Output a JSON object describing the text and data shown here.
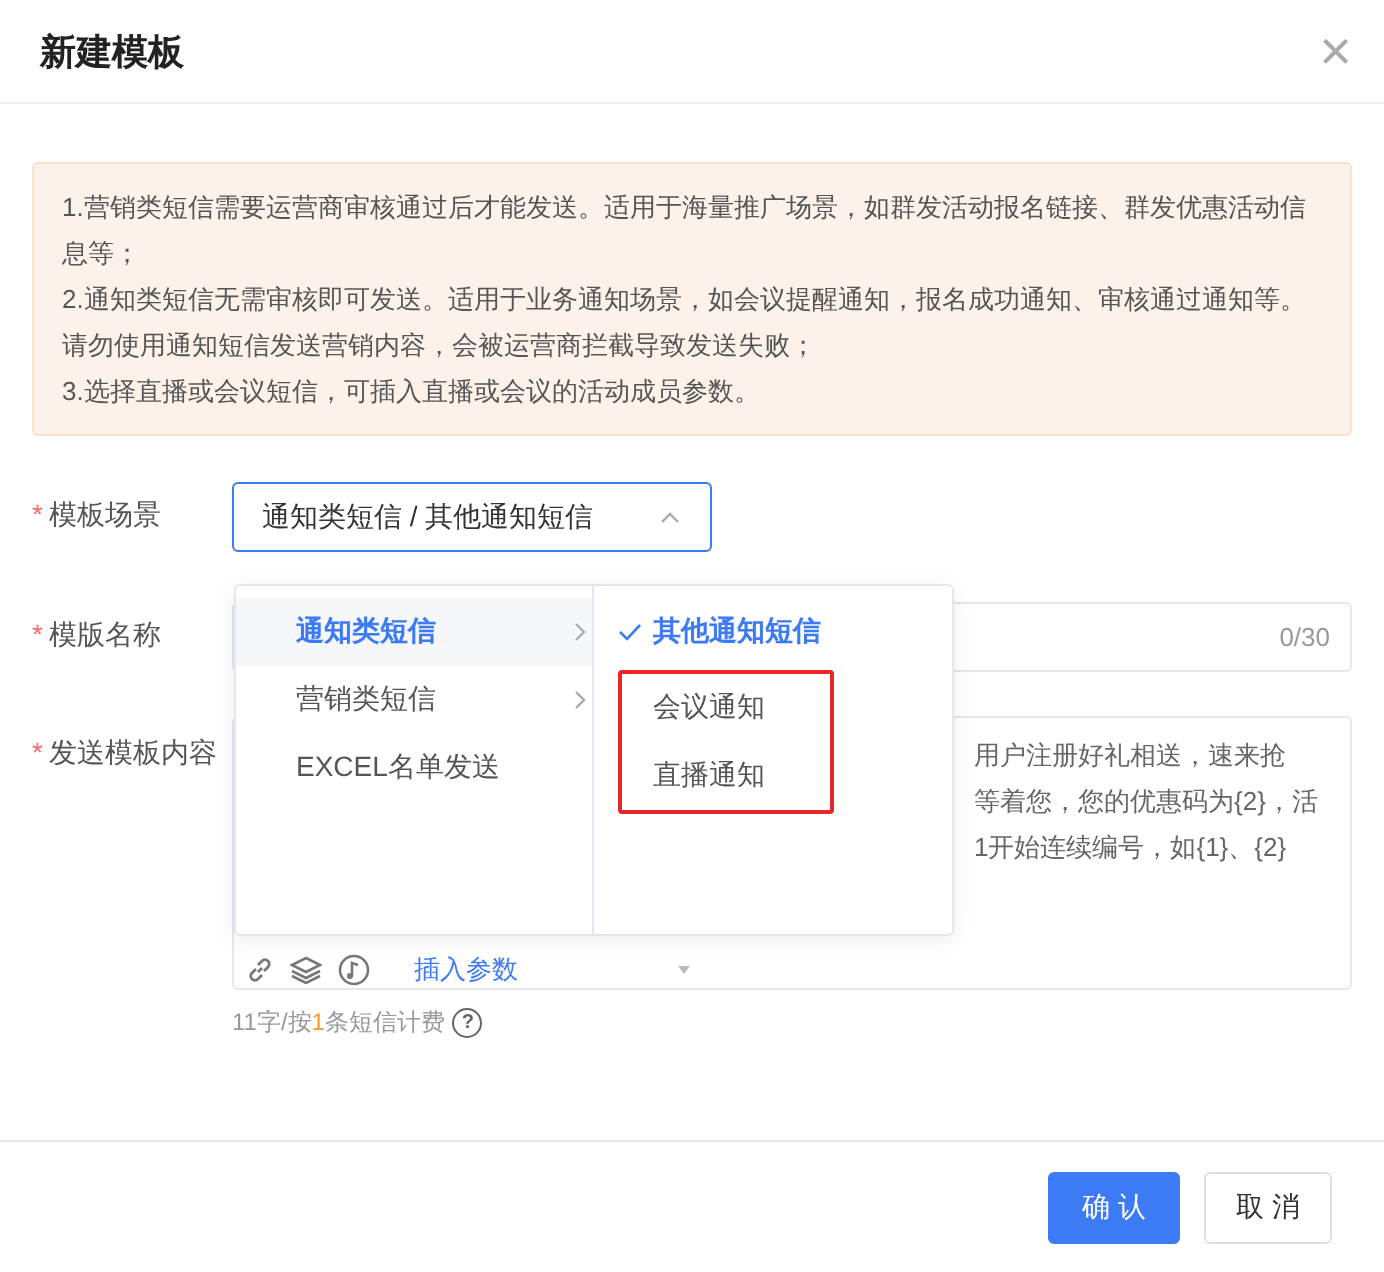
{
  "dialog": {
    "title": "新建模板",
    "close": "×"
  },
  "notice": [
    "1.营销类短信需要运营商审核通过后才能发送。适用于海量推广场景，如群发活动报名链接、群发优惠活动信息等；",
    "2.通知类短信无需审核即可发送。适用于业务通知场景，如会议提醒通知，报名成功通知、审核通过通知等。请勿使用通知短信发送营销内容，会被运营商拦截导致发送失败；",
    "3.选择直播或会议短信，可插入直播或会议的活动成员参数。"
  ],
  "form": {
    "scene": {
      "label": "模板场景",
      "required_mark": "*",
      "value": "通知类短信 / 其他通知短信",
      "expanded": true
    },
    "name": {
      "label": "模版名称",
      "required_mark": "*",
      "counter": "0/30"
    },
    "content": {
      "label": "发送模板内容",
      "required_mark": "*",
      "visible_lines": [
        "用户注册好礼相送，速来抢",
        "等着您，您的优惠码为{2}，活",
        "1开始连续编号，如{1}、{2}"
      ],
      "insert_label": "插入参数"
    },
    "billing": {
      "before": "11字/按",
      "count": "1",
      "after": "条短信计费",
      "help": "?"
    }
  },
  "cascader": {
    "level_1": [
      {
        "label": "通知类短信",
        "selected": true,
        "has_children": true
      },
      {
        "label": "营销类短信",
        "selected": false,
        "has_children": true
      },
      {
        "label": "EXCEL名单发送",
        "selected": false,
        "has_children": false
      }
    ],
    "level_2": [
      {
        "label": "其他通知短信",
        "selected": true,
        "annotated": false
      },
      {
        "label": "会议通知",
        "selected": false,
        "annotated": true
      },
      {
        "label": "直播通知",
        "selected": false,
        "annotated": true
      }
    ]
  },
  "buttons": [
    {
      "label": "确 认",
      "kind": "primary"
    },
    {
      "label": "取 消",
      "kind": "default"
    }
  ]
}
